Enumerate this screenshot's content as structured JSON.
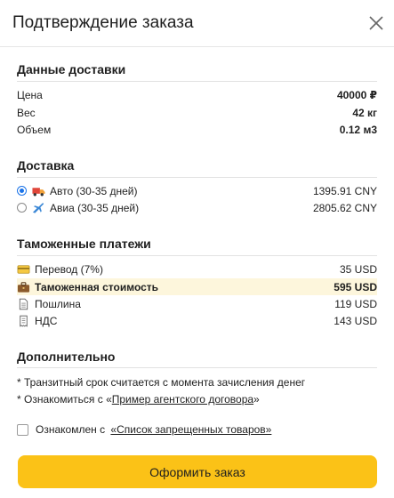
{
  "header": {
    "title": "Подтверждение заказа",
    "close_icon": "close-icon"
  },
  "delivery_data": {
    "title": "Данные доставки",
    "rows": [
      {
        "label": "Цена",
        "value": "40000 ₽"
      },
      {
        "label": "Вес",
        "value": "42 кг"
      },
      {
        "label": "Объем",
        "value": "0.12 м3"
      }
    ]
  },
  "shipping": {
    "title": "Доставка",
    "options": [
      {
        "label": "Авто (30-35 дней)",
        "value": "1395.91 CNY",
        "selected": true,
        "icon": "truck-icon"
      },
      {
        "label": "Авиа (30-35 дней)",
        "value": "2805.62 CNY",
        "selected": false,
        "icon": "airplane-icon"
      }
    ]
  },
  "customs": {
    "title": "Таможенные платежи",
    "rows": [
      {
        "label": "Перевод (7%)",
        "value": "35 USD",
        "icon": "credit-card-icon"
      },
      {
        "label": "Таможенная стоимость",
        "value": "595 USD",
        "icon": "briefcase-icon"
      },
      {
        "label": "Пошлина",
        "value": "119 USD",
        "icon": "document-icon"
      },
      {
        "label": "НДС",
        "value": "143 USD",
        "icon": "receipt-icon"
      }
    ]
  },
  "additional": {
    "title": "Дополнительно",
    "note1": "* Транзитный срок считается с момента зачисления денег",
    "note2_prefix": "* Ознакомиться с «",
    "note2_link": "Пример агентского договора",
    "note2_suffix": "»",
    "agree_prefix": "Ознакомлен с ",
    "agree_link": "«Список запрещенных товаров»"
  },
  "submit_label": "Оформить заказ",
  "colors": {
    "accent": "#fbc217",
    "highlight": "#fdf6dc",
    "radio": "#1a73e8"
  }
}
